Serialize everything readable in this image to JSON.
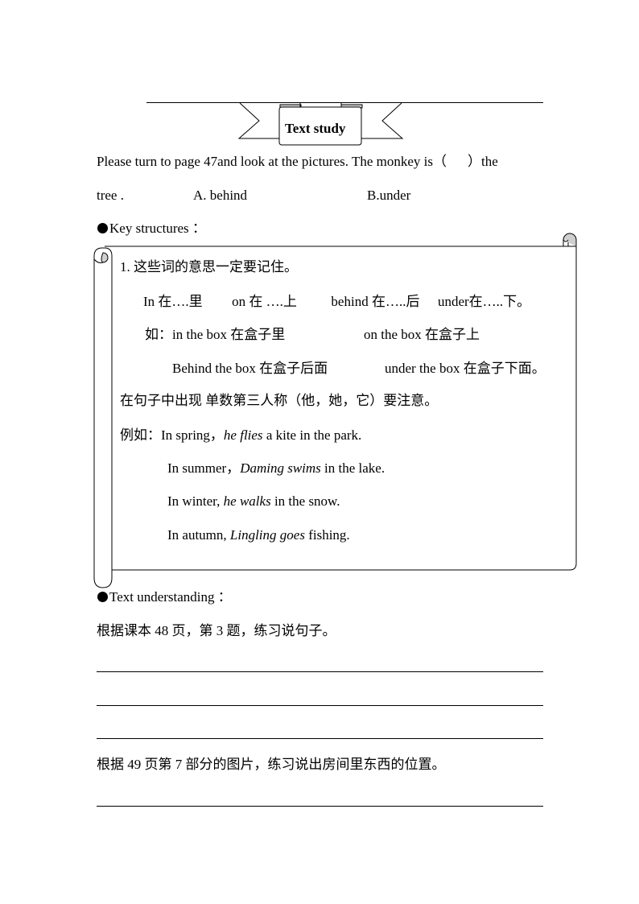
{
  "banner": {
    "title": "Text study"
  },
  "intro": {
    "question_line1_a": "Please turn to page 47and look at the pictures. The monkey is（",
    "question_line1_b": "）the",
    "question_line2": "tree .",
    "option_a": "A. behind",
    "option_b": "B.under"
  },
  "key_structures": {
    "heading": "Key structures ：",
    "item1": "1. 这些词的意思一定要记住。",
    "words": [
      {
        "en": "In",
        "zh": "在….里"
      },
      {
        "en": "on",
        "zh": "在 ….上"
      },
      {
        "en": "behind",
        "zh": "在…..后"
      },
      {
        "en": "under",
        "zh": "在…..下。"
      }
    ],
    "example_prefix": "如：",
    "phrases": [
      {
        "en": "in the box",
        "zh": "在盒子里"
      },
      {
        "en": "on the box",
        "zh": "在盒子上"
      },
      {
        "en": "Behind the box",
        "zh": "在盒子后面"
      },
      {
        "en": "under the box",
        "zh": "在盒子下面。"
      }
    ],
    "note": "在句子中出现 单数第三人称（他，她，它）要注意。",
    "sentences_prefix": "例如：",
    "sentences": [
      {
        "pre": "In spring，",
        "it": "he flies",
        "post": " a kite in the park."
      },
      {
        "pre": "In summer，",
        "it": "Daming swims",
        "post": " in the lake."
      },
      {
        "pre": "In winter, ",
        "it": "he walks",
        "post": " in the snow."
      },
      {
        "pre": "In autumn, ",
        "it": "Lingling goes",
        "post": " fishing."
      }
    ]
  },
  "text_understanding": {
    "heading": "Text understanding ：",
    "task1": "根据课本 48 页，第 3 题，练习说句子。",
    "task2": "根据 49 页第 7 部分的图片，练习说出房间里东西的位置。"
  }
}
